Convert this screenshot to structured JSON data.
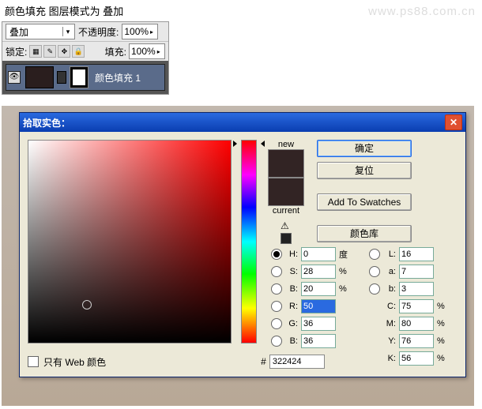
{
  "watermark": "www.ps88.com.cn",
  "top_line": "颜色填充  图层模式为  叠加",
  "blend": {
    "label": "叠加",
    "opacity_label": "不透明度:",
    "opacity": "100%"
  },
  "lock": {
    "label": "锁定:",
    "fill_label": "填充:",
    "fill": "100%"
  },
  "layer": {
    "name": "颜色填充 1"
  },
  "dialog": {
    "title": "拾取实色：",
    "new_label": "new",
    "current_label": "current",
    "buttons": {
      "ok": "确定",
      "reset": "复位",
      "add": "Add To Swatches",
      "lib": "颜色库"
    },
    "h": {
      "lbl": "H:",
      "val": "0",
      "unit": "度"
    },
    "s": {
      "lbl": "S:",
      "val": "28",
      "unit": "%"
    },
    "br": {
      "lbl": "B:",
      "val": "20",
      "unit": "%"
    },
    "r": {
      "lbl": "R:",
      "val": "50"
    },
    "g": {
      "lbl": "G:",
      "val": "36"
    },
    "b": {
      "lbl": "B:",
      "val": "36"
    },
    "L": {
      "lbl": "L:",
      "val": "16"
    },
    "a": {
      "lbl": "a:",
      "val": "7"
    },
    "bb": {
      "lbl": "b:",
      "val": "3"
    },
    "C": {
      "lbl": "C:",
      "val": "75",
      "unit": "%"
    },
    "M": {
      "lbl": "M:",
      "val": "80",
      "unit": "%"
    },
    "Y": {
      "lbl": "Y:",
      "val": "76",
      "unit": "%"
    },
    "K": {
      "lbl": "K:",
      "val": "56",
      "unit": "%"
    },
    "hex": "322424",
    "web_only": "只有 Web 颜色"
  }
}
